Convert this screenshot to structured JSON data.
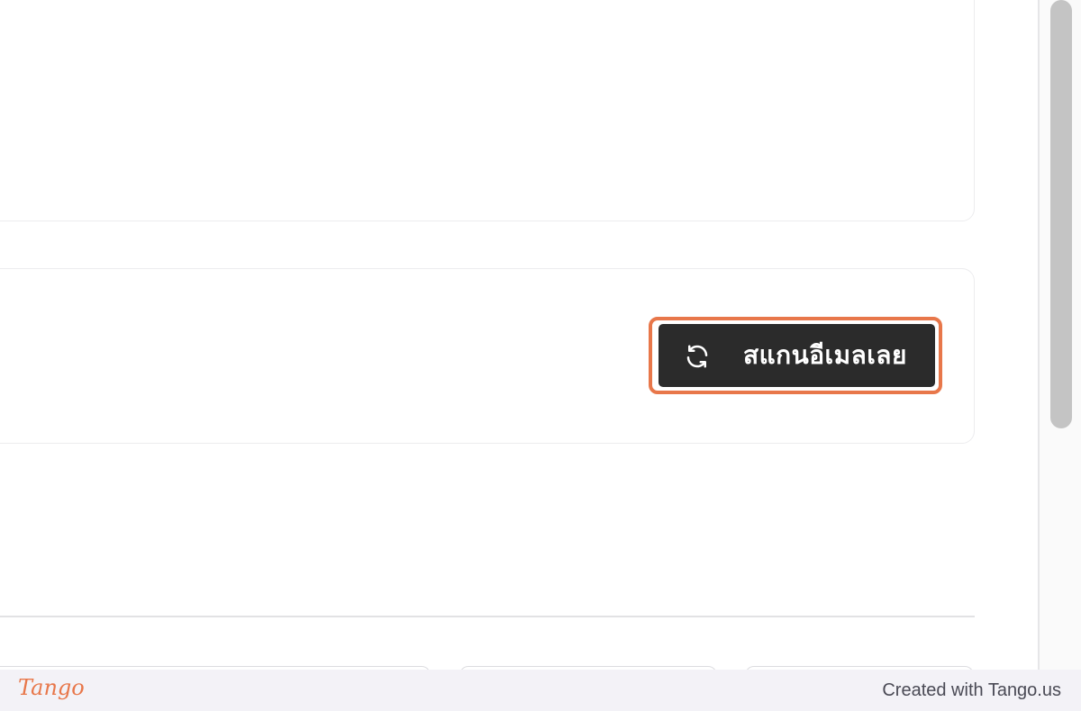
{
  "main": {
    "scan_button": {
      "label": "สแกนอีเมลเลย",
      "icon": "refresh-icon"
    }
  },
  "footer": {
    "logo_text": "Tango",
    "credit_text": "Created with Tango.us"
  },
  "colors": {
    "highlight": "#e8774a",
    "button_bg": "#2b2b2b",
    "footer_bg": "#f3f2f7"
  }
}
